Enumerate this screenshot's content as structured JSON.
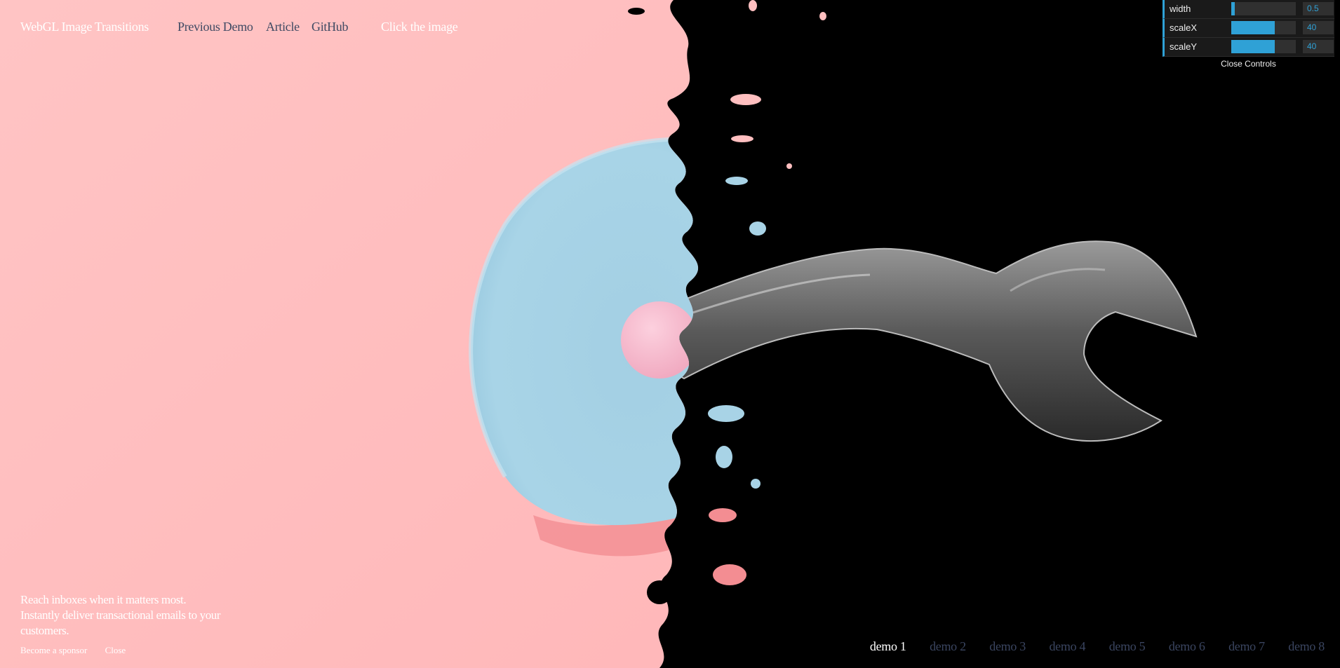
{
  "header": {
    "title": "WebGL Image Transitions",
    "nav": {
      "previous": "Previous Demo",
      "article": "Article",
      "github": "GitHub"
    },
    "hint": "Click the image"
  },
  "controls": {
    "rows": [
      {
        "label": "width",
        "value": "0.5",
        "level": 0.05
      },
      {
        "label": "scaleX",
        "value": "40",
        "level": 0.67
      },
      {
        "label": "scaleY",
        "value": "40",
        "level": 0.67
      }
    ],
    "close_label": "Close Controls"
  },
  "sponsor": {
    "text": "Reach inboxes when it matters most. Instantly deliver transactional emails to your customers.",
    "become": "Become a sponsor",
    "close": "Close"
  },
  "demos": {
    "items": [
      "demo 1",
      "demo 2",
      "demo 3",
      "demo 4",
      "demo 5",
      "demo 6",
      "demo 7",
      "demo 8"
    ],
    "active": "demo 1"
  },
  "colors": {
    "pink_bg": "#ffbfc0",
    "bowl_blue": "#a8d3e6",
    "ball_pink": "#f6b7cb",
    "accent": "#2fa1d6",
    "nav_dark": "#3f4a63"
  }
}
